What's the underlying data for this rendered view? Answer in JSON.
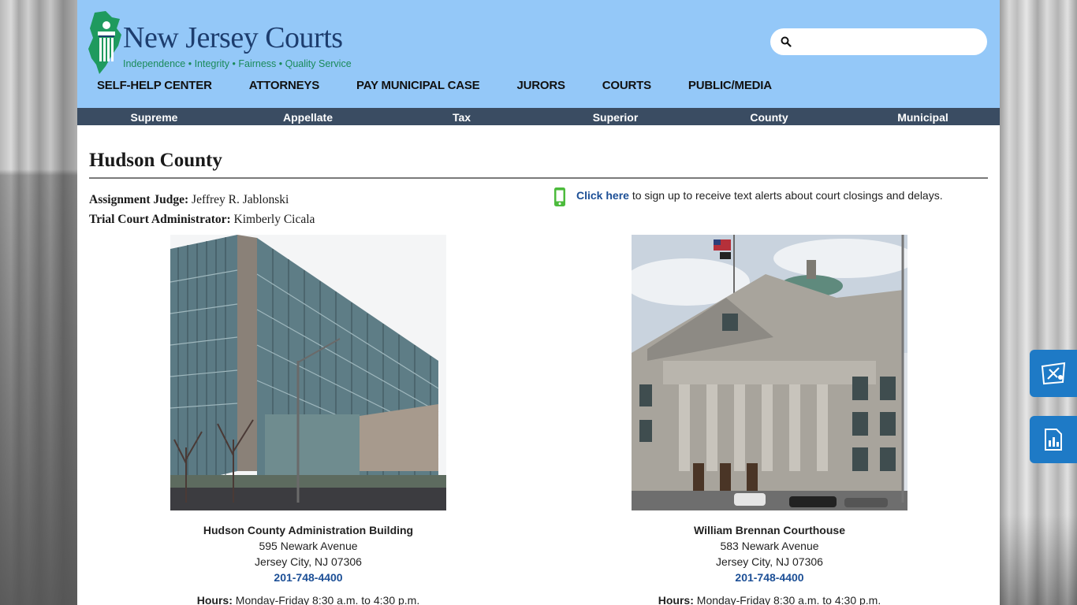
{
  "site": {
    "name": "New Jersey Courts",
    "tagline": "Independence • Integrity • Fairness • Quality Service"
  },
  "search": {
    "placeholder": "",
    "value": ""
  },
  "main_nav": [
    "SELF-HELP CENTER",
    "ATTORNEYS",
    "PAY MUNICIPAL CASE",
    "JURORS",
    "COURTS",
    "PUBLIC/MEDIA"
  ],
  "sub_nav": [
    "Supreme",
    "Appellate",
    "Tax",
    "Superior",
    "County",
    "Municipal"
  ],
  "page": {
    "title": "Hudson County",
    "assignment_judge_label": "Assignment Judge:",
    "assignment_judge": "Jeffrey R. Jablonski",
    "tca_label": "Trial Court Administrator:",
    "tca": "Kimberly Cicala"
  },
  "alert": {
    "link": "Click here",
    "text": " to sign up to receive text alerts about court closings and delays."
  },
  "locations": [
    {
      "name": "Hudson County Administration Building",
      "street": "595 Newark Avenue",
      "city": "Jersey City, NJ 07306",
      "phone": "201-748-4400",
      "hours_label": "Hours:",
      "hours": " Monday-Friday 8:30 a.m. to 4:30 p.m."
    },
    {
      "name": "William Brennan Courthouse",
      "street": "583 Newark Avenue",
      "city": "Jersey City, NJ 07306",
      "phone": "201-748-4400",
      "hours_label": "Hours:",
      "hours": " Monday-Friday 8:30 a.m. to 4:30 p.m."
    }
  ],
  "colors": {
    "header": "#94c8f8",
    "subnav": "#3a4c62",
    "link": "#1c4f96",
    "side_button": "#1e7ac6",
    "phone_icon": "#4cbb3c"
  },
  "icons": {
    "search": "search-icon",
    "phone": "mobile-phone-icon",
    "side1": "courthouse-help-icon",
    "side2": "document-chart-icon"
  }
}
